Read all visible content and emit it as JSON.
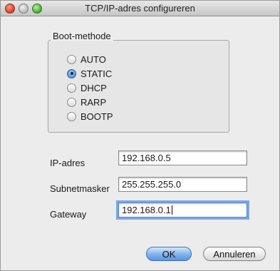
{
  "window": {
    "title": "TCP/IP-adres configureren"
  },
  "boot_method": {
    "label": "Boot-methode",
    "options": [
      {
        "label": "AUTO",
        "checked": false
      },
      {
        "label": "STATIC",
        "checked": true
      },
      {
        "label": "DHCP",
        "checked": false
      },
      {
        "label": "RARP",
        "checked": false
      },
      {
        "label": "BOOTP",
        "checked": false
      }
    ]
  },
  "fields": {
    "ip": {
      "label": "IP-adres",
      "value": "192.168.0.5"
    },
    "subnet": {
      "label": "Subnetmasker",
      "value": "255.255.255.0"
    },
    "gateway": {
      "label": "Gateway",
      "value": "192.168.0.1"
    }
  },
  "buttons": {
    "ok": "OK",
    "cancel": "Annuleren"
  }
}
